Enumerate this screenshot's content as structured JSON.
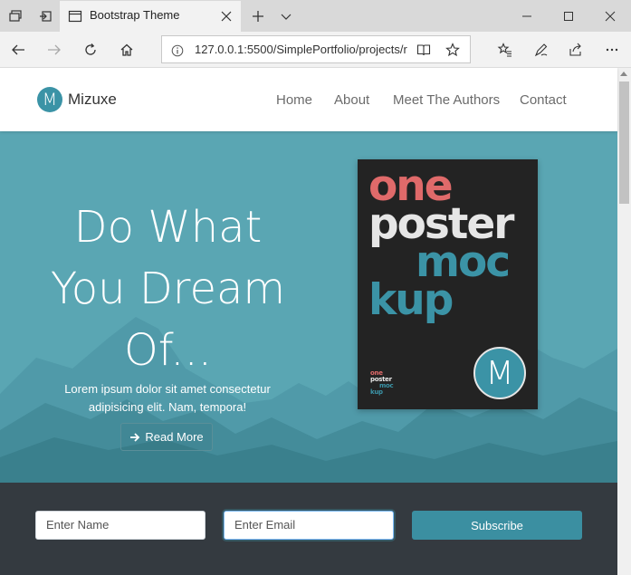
{
  "browser": {
    "tab_title": "Bootstrap Theme",
    "url": "127.0.0.1:5500/SimplePortfolio/projects/r"
  },
  "site": {
    "logo_letter": "M",
    "brand": "Mizuxe",
    "menu": [
      "Home",
      "About",
      "Meet The Authors",
      "Contact"
    ]
  },
  "hero": {
    "title_lines": [
      "Do What",
      "You Dream",
      "Of..."
    ],
    "text": "Lorem ipsum dolor sit amet consectetur adipisicing elit. Nam, tempora!",
    "button_label": "Read More"
  },
  "poster": {
    "words": [
      "one",
      "poster",
      "moc",
      "kup"
    ],
    "badge_letter": "M",
    "colors": {
      "coral": "#e06a6a",
      "light": "#e6e6e6",
      "teal": "#3b93a6",
      "bg": "#232323"
    }
  },
  "subscribe": {
    "name_placeholder": "Enter Name",
    "email_placeholder": "Enter Email",
    "button_label": "Subscribe"
  },
  "colors": {
    "accent": "#3b93a6",
    "hero_bg": "#5aa6b3",
    "band_bg": "#343a40"
  }
}
